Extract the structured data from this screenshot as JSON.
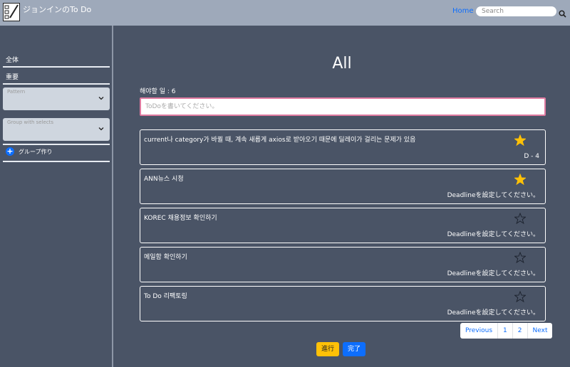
{
  "navbar": {
    "brand": "ジョンインのTo Do",
    "home_label": "Home",
    "search_placeholder": "Search"
  },
  "sidebar": {
    "items": [
      {
        "label": "全体"
      },
      {
        "label": "重要"
      }
    ],
    "selects": [
      {
        "label": "Pattern"
      },
      {
        "label": "Group with selects"
      }
    ],
    "group_button_label": "グループ作り"
  },
  "main": {
    "title": "All",
    "count_label": "해야할 일 : 6",
    "input_placeholder": "ToDoを書いてください。",
    "todos": [
      {
        "text": "current나 category가 바뀔 때, 계속 새롭게 axios로 받아오기 때문에 딜레이가 걸리는 문제가 있음",
        "starred": true,
        "deadline": "D - 4"
      },
      {
        "text": "ANN뉴스 시청",
        "starred": true,
        "deadline": "Deadlineを設定してください。"
      },
      {
        "text": "KOREC 채용정보 확인하기",
        "starred": false,
        "deadline": "Deadlineを設定してください。"
      },
      {
        "text": "메일함 확인하기",
        "starred": false,
        "deadline": "Deadlineを設定してください。"
      },
      {
        "text": "To Do 리팩토링",
        "starred": false,
        "deadline": "Deadlineを設定してください。"
      }
    ],
    "pagination": [
      "Previous",
      "1",
      "2",
      "Next"
    ],
    "progress_button": "進行",
    "done_button": "完了"
  },
  "colors": {
    "accent": "#0d6efd",
    "star_filled": "#ffc107",
    "background": "#4a5466",
    "navbar": "#9ea9ba",
    "input_border": "#e07aa0"
  }
}
